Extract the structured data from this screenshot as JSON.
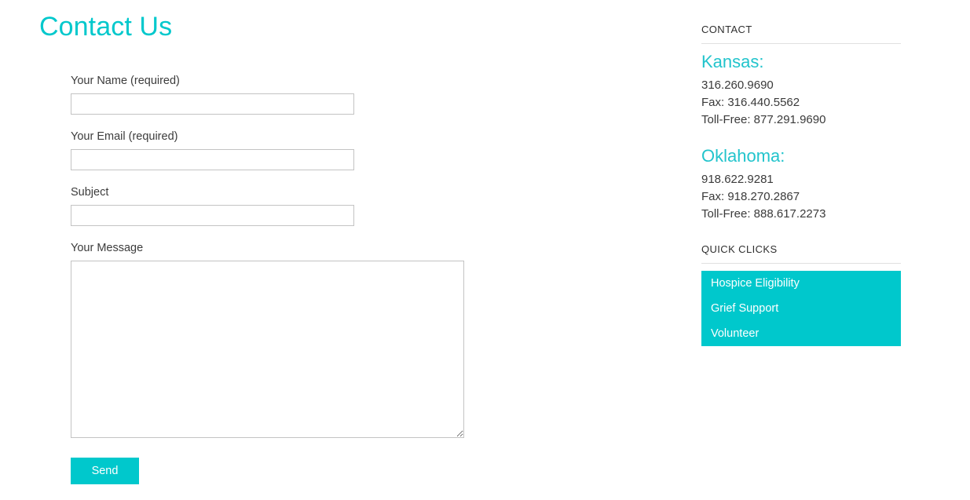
{
  "page": {
    "title": "Contact Us"
  },
  "form": {
    "fields": [
      {
        "key": "name",
        "label": "Your Name (required)",
        "value": "",
        "placeholder": "",
        "type": "text"
      },
      {
        "key": "email",
        "label": "Your Email (required)",
        "value": "",
        "placeholder": "",
        "type": "text"
      },
      {
        "key": "subject",
        "label": "Subject",
        "value": "",
        "placeholder": "",
        "type": "text"
      },
      {
        "key": "message",
        "label": "Your Message",
        "value": "",
        "placeholder": "",
        "type": "textarea"
      }
    ],
    "submit_label": "Send"
  },
  "sidebar": {
    "contact_widget": {
      "title": "CONTACT",
      "locations": [
        {
          "name": "Kansas:",
          "lines": [
            "316.260.9690",
            "Fax: 316.440.5562",
            "Toll-Free: 877.291.9690"
          ]
        },
        {
          "name": "Oklahoma:",
          "lines": [
            "918.622.9281",
            "Fax: 918.270.2867",
            "Toll-Free: 888.617.2273"
          ]
        }
      ]
    },
    "quick_clicks_widget": {
      "title": "QUICK CLICKS",
      "links": [
        {
          "label": "Hospice Eligibility"
        },
        {
          "label": "Grief Support"
        },
        {
          "label": "Volunteer"
        }
      ]
    }
  },
  "colors": {
    "accent_teal": "#00c8cc",
    "heading_teal": "#22c4cc",
    "body_text": "#333333",
    "input_border": "#c3c3c3",
    "divider": "#e0e0e0"
  }
}
